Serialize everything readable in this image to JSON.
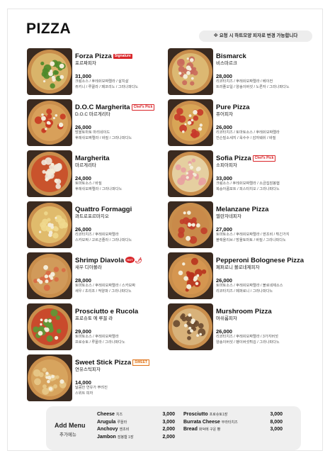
{
  "header": {
    "title": "PIZZA",
    "notice": "※ 요청 시 하트모양 피자로 변경 가능합니다"
  },
  "left_items": [
    {
      "name_en": "Forza Pizza",
      "name_ko": "포르짜피자",
      "badge": "Signature",
      "price": "31,000",
      "desc": [
        "크림소스 / 후레쉬모짜렐라 / 살치살",
        "쥬키니 / 루꼴라 / 페코리노 / 그라나파다노"
      ],
      "topping": "#4e8a2a",
      "base": "#d9b46a"
    },
    {
      "name_en": "D.O.C Margherita",
      "name_ko": "D.O.C 마르게리타",
      "badge": "Chef's Pick",
      "price": "26,000",
      "desc": [
        "방울토마토 마리네이드",
        "후레쉬모짜렐라 / 바질 / 그라나파다노"
      ],
      "topping": "#c83a22",
      "base": "#d8a05a"
    },
    {
      "name_en": "Margherita",
      "name_ko": "마르게리타",
      "badge": "",
      "price": "24,000",
      "desc": [
        "토마토소스 / 바질",
        "후레쉬모짜렐라 / 그라나파다노"
      ],
      "topping": "#efe9dc",
      "base": "#c9532c"
    },
    {
      "name_en": "Quattro Formaggi",
      "name_ko": "콰트로포르마지오",
      "badge": "",
      "price": "26,000",
      "desc": [
        "리코타치즈 / 후레쉬모짜렐라",
        "스카모짜 / 고르곤졸라 / 그라나파다노"
      ],
      "topping": "#f0d98e",
      "base": "#e0bb6c"
    },
    {
      "name_en": "Shrimp Diavola",
      "name_ko": "새우 디아볼라",
      "badge": "HOT",
      "price": "28,000",
      "desc": [
        "토마토소스 / 후레쉬모짜렐라 / 스카모짜",
        "새우 / 초리조 / 적양파 / 그라나파다노"
      ],
      "topping": "#d86a44",
      "base": "#d19a5a"
    },
    {
      "name_en": "Prosciutto e Rucola",
      "name_ko": "프로슈토 에 루꼴 라",
      "badge": "",
      "price": "29,000",
      "desc": [
        "토마토소스 / 후레쉬모짜렐라",
        "프로슈토 / 루꼴라 / 그라나파다노"
      ],
      "topping": "#5c9a36",
      "base": "#c94a2c"
    },
    {
      "name_en": "Sweet Stick Pizza",
      "name_ko": "연유스틱피자",
      "badge": "SWEET",
      "price": "14,000",
      "desc": [
        "달콤한 연유가 뿌려진",
        "스위트 피자"
      ],
      "topping": "#e8c98a",
      "base": "#d7a45e"
    }
  ],
  "right_items": [
    {
      "name_en": "Bismarck",
      "name_ko": "비스마르크",
      "badge": "",
      "price": "28,000",
      "desc": [
        "리코타치즈 / 후레쉬모짜렐라 / 베이컨",
        "트러플오일 / 양송이버섯 / 노른자 / 그라나파다노"
      ],
      "topping": "#c96a5c",
      "base": "#dcb872"
    },
    {
      "name_en": "Pure Pizza",
      "name_ko": "퓨어피자",
      "badge": "",
      "price": "26,000",
      "desc": [
        "리코타치즈 / 토마토소스 / 후레쉬모짜렐라",
        "잔슨빌소세지 / 옥수수 / 감자웨쉬 / 바질"
      ],
      "topping": "#c7392a",
      "base": "#d8a556"
    },
    {
      "name_en": "Sofia Pizza",
      "name_ko": "소피아피자",
      "badge": "Chef's Pick",
      "price": "33,000",
      "desc": [
        "크림소스 / 후레쉬모짜렐라 / 소금집잠봉햄",
        "복숭아콤포트 / 피스타치오 / 그라나파다노"
      ],
      "topping": "#e8a0a0",
      "base": "#e5cfa0"
    },
    {
      "name_en": "Melanzane Pizza",
      "name_ko": "멜란자네피자",
      "badge": "",
      "price": "27,000",
      "desc": [
        "토마토소스 / 후레쉬모짜렐라 / 엔초비 / 튀긴가지",
        "블랙올리브 / 방울토마토 / 바질 / 그라나파다노"
      ],
      "topping": "#c13d2a",
      "base": "#c98a4a"
    },
    {
      "name_en": "Pepperoni Bolognese Pizza",
      "name_ko": "페퍼로니 볼로네제피자",
      "badge": "",
      "price": "26,000",
      "desc": [
        "토마토소스 / 후레쉬모짜렐라 / 볼로네제소스",
        "리코타치즈 / 페퍼로니 / 그라나파다노"
      ],
      "topping": "#b8321e",
      "base": "#d59650"
    },
    {
      "name_en": "Murshroom Pizza",
      "name_ko": "머쉬룸피자",
      "badge": "",
      "price": "26,000",
      "desc": [
        "리코타치즈 / 후레쉬모짜렐라 / 3가지버섯",
        "양송이버섯 / 팽이버섯튀김 / 그라나파다노"
      ],
      "topping": "#6a4a30",
      "base": "#d8b27a"
    }
  ],
  "add_menu": {
    "title": "Add Menu",
    "title_ko": "추가메뉴",
    "col1": [
      {
        "name": "Cheese",
        "sub": "치즈",
        "price": "3,000"
      },
      {
        "name": "Arugula",
        "sub": "루꼴라",
        "price": "3,000"
      },
      {
        "name": "Anchovy",
        "sub": "엔초비",
        "price": "2,000"
      },
      {
        "name": "Jambon",
        "sub": "잠봉햄 1장",
        "price": "2,000"
      }
    ],
    "col2": [
      {
        "name": "Prosciutto",
        "sub": "프로슈토1장",
        "price": "3,000"
      },
      {
        "name": "Burrata Cheese",
        "sub": "부라타치즈",
        "price": "8,000"
      },
      {
        "name": "Bread",
        "sub": "화덕에 구운 빵",
        "price": "3,000"
      }
    ]
  }
}
